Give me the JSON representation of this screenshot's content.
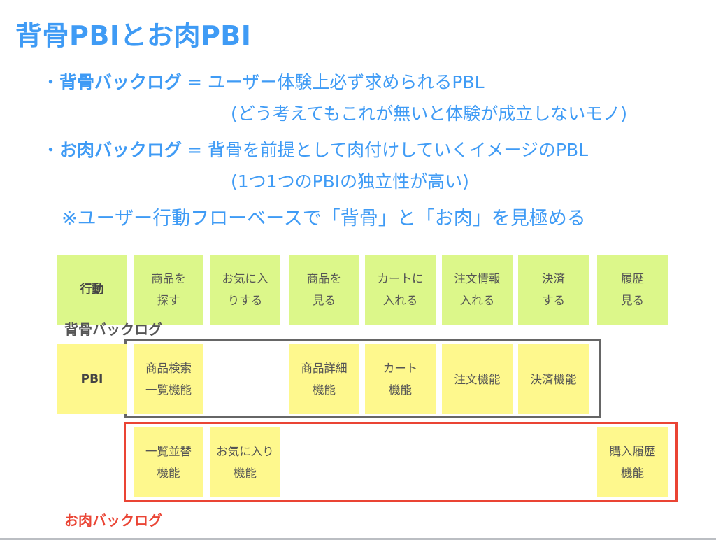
{
  "title": "背骨PBIとお肉PBI",
  "definitions": [
    {
      "bullet": "・",
      "term": "背骨バックログ",
      "equals": " = ",
      "description": "ユーザー体験上必ず求められるPBL",
      "note": "(どう考えてもこれが無いと体験が成立しないモノ)"
    },
    {
      "bullet": "・",
      "term": "お肉バックログ",
      "equals": " = ",
      "description": "背骨を前提として肉付けしていくイメージのPBL",
      "note": "(1つ1つのPBIの独立性が高い)"
    }
  ],
  "remark": "※ユーザー行動フローベースで「背骨」と「お肉」を見極める",
  "colors": {
    "accent": "#3f9bf5",
    "action_card": "#dcf78a",
    "pbi_card": "#fef88d",
    "spine_frame": "#666666",
    "meat_frame": "#ea4434"
  },
  "diagram": {
    "actions_label": "行動",
    "pbi_label": "PBI",
    "actions": [
      "商品を\n探す",
      "お気に入\nりする",
      "商品を\n見る",
      "カートに\n入れる",
      "注文情報\n入れる",
      "決済\nする",
      "履歴\n見る"
    ],
    "spine_label": "背骨バックログ",
    "spine_pbis": [
      "商品検索\n一覧機能",
      "商品詳細\n機能",
      "カート\n機能",
      "注文機能",
      "決済機能"
    ],
    "meat_label": "お肉バックログ",
    "meat_pbis": [
      "一覧並替\n機能",
      "お気に入り\n機能",
      "購入履歴\n機能"
    ]
  }
}
